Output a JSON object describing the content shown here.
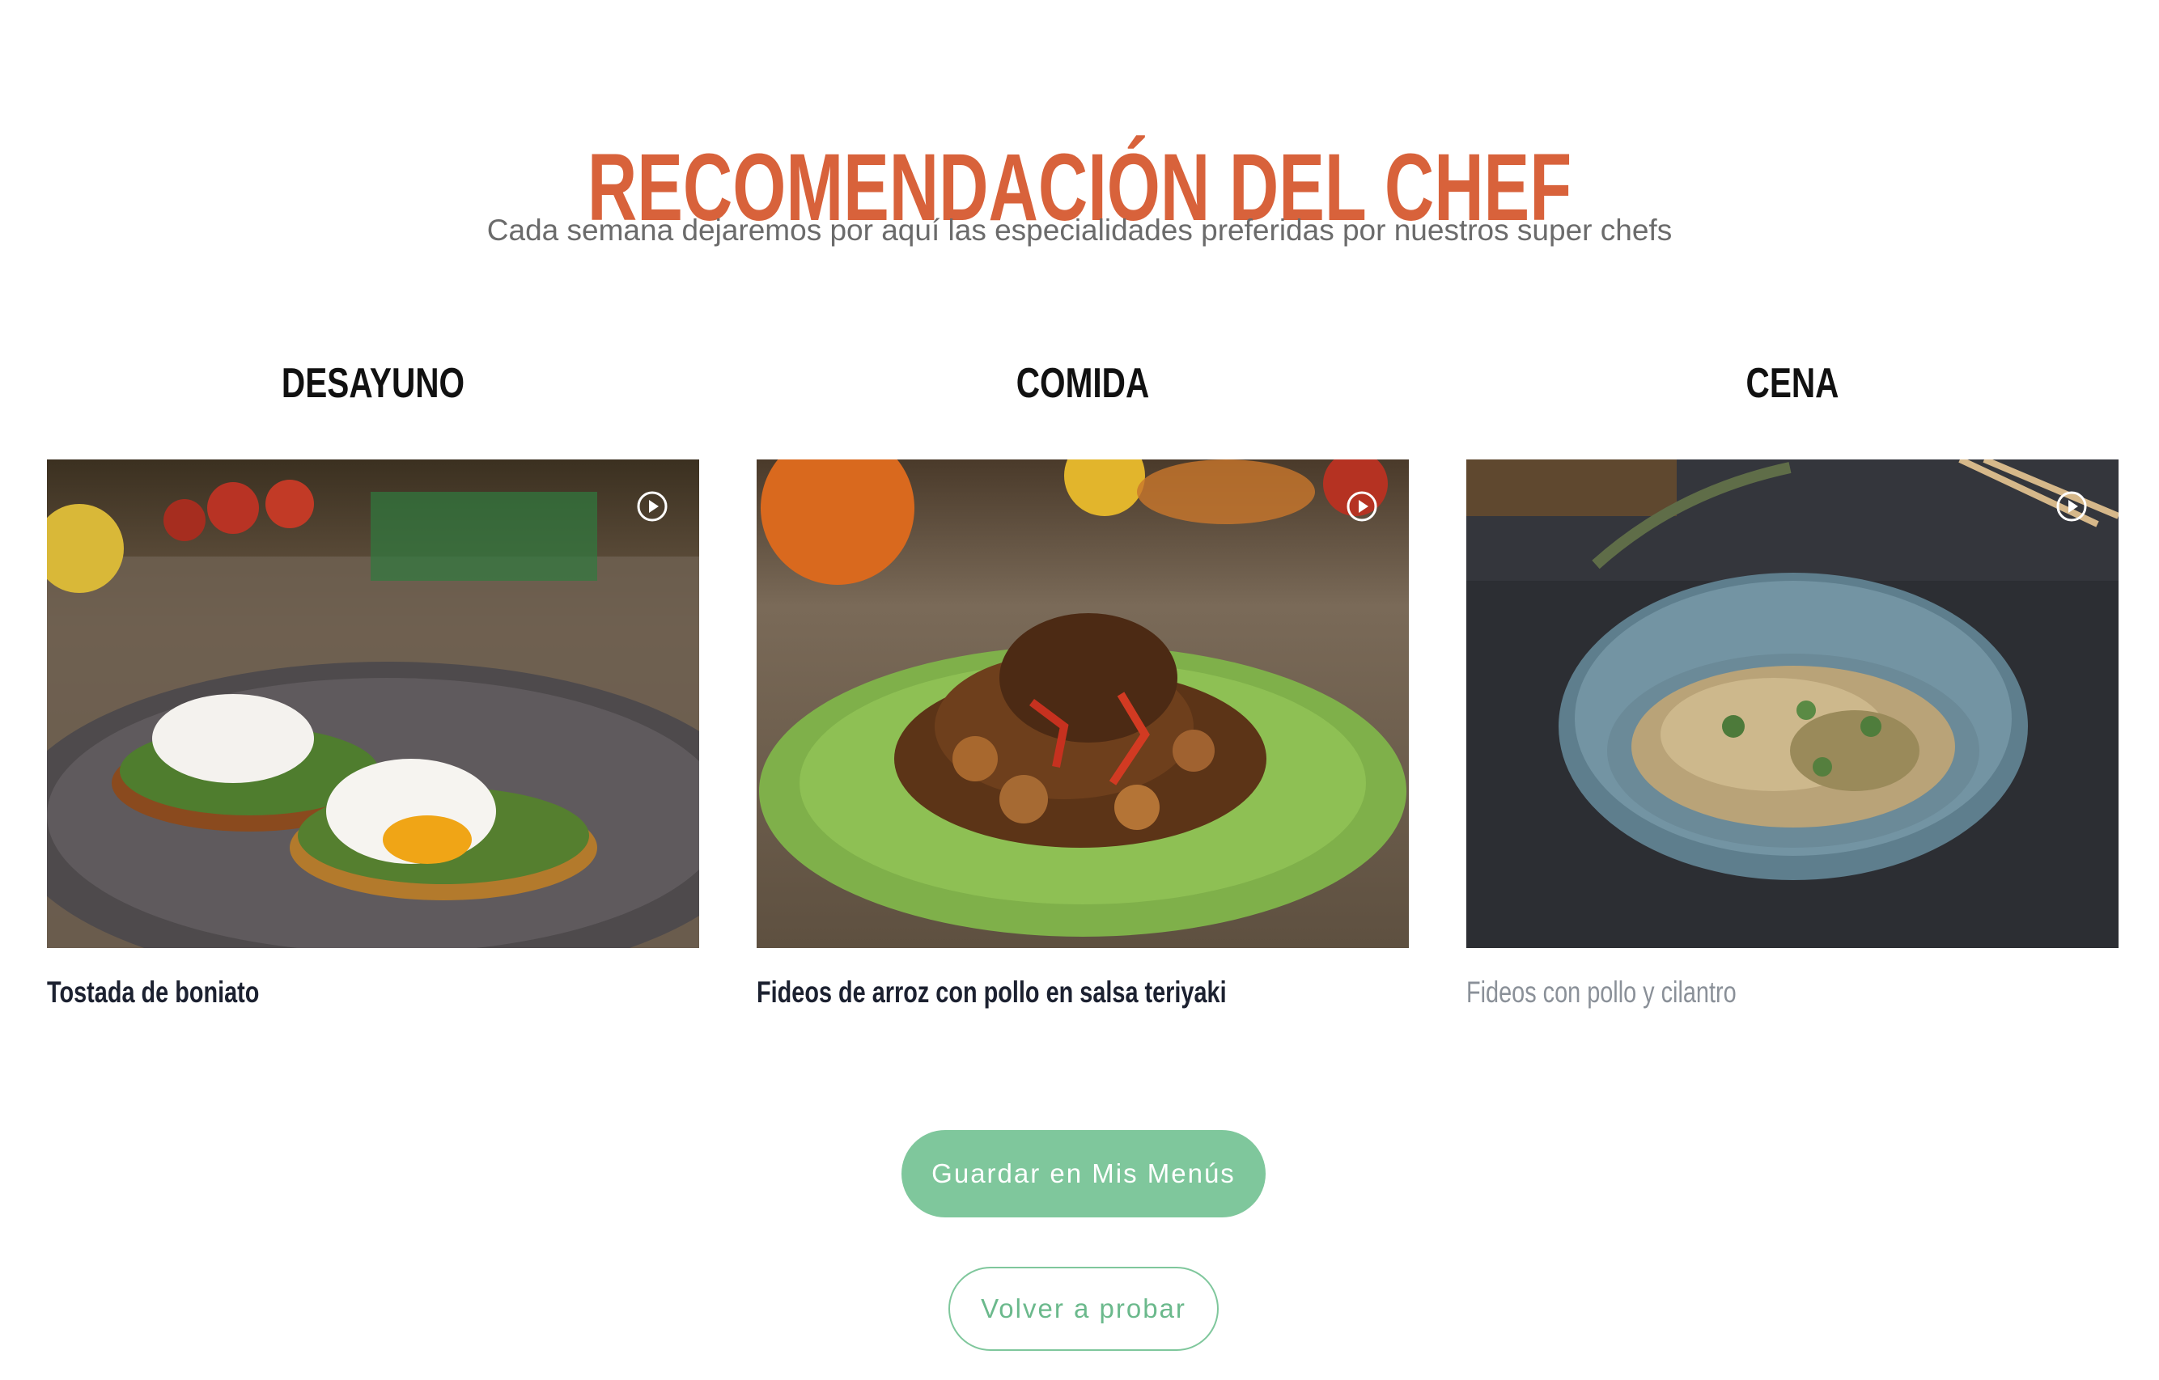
{
  "header": {
    "title": "RECOMENDACIÓN DEL CHEF",
    "subtitle": "Cada semana dejaremos por aquí las especialidades preferidas por nuestros super chefs"
  },
  "meals": [
    {
      "heading": "DESAYUNO",
      "recipe": "Tostada de boniato",
      "image": "poached-eggs-on-sweet-potato-toast",
      "icon": "play-icon"
    },
    {
      "heading": "COMIDA",
      "recipe": "Fideos de arroz con pollo en salsa teriyaki",
      "image": "teriyaki-chicken-rice-noodles-on-green-plate",
      "icon": "play-icon"
    },
    {
      "heading": "CENA",
      "recipe": "Fideos con pollo y cilantro",
      "image": "chicken-cilantro-noodles-in-blue-bowl",
      "icon": "play-icon"
    }
  ],
  "actions": {
    "save_label": "Guardar en Mis Menús",
    "retry_label": "Volver a probar"
  },
  "colors": {
    "title": "#d8623b",
    "button": "#7fc79c",
    "button_outline_text": "#6bb98c"
  }
}
